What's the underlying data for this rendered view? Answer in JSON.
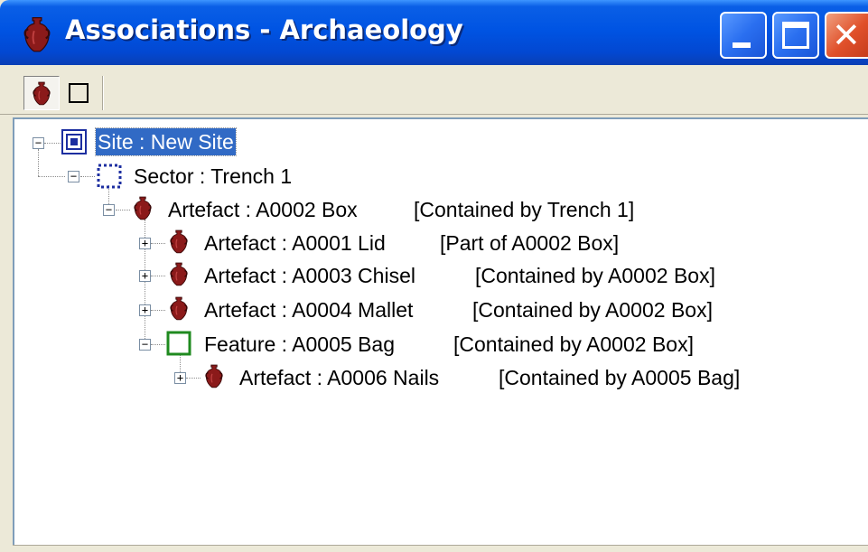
{
  "window": {
    "title": "Associations - Archaeology",
    "buttons": {
      "minimize": "minimize",
      "maximize": "maximize",
      "close": "close"
    }
  },
  "toolbar": {
    "items": [
      {
        "icon": "amphora-icon",
        "state": "pressed"
      },
      {
        "icon": "square-icon",
        "state": "normal"
      }
    ]
  },
  "tree": {
    "nodes": [
      {
        "label": "Site : New Site",
        "relation": "",
        "icon": "site-icon",
        "expander": "−",
        "selected": true
      },
      {
        "label": "Sector : Trench 1",
        "relation": "",
        "icon": "sector-icon",
        "expander": "−"
      },
      {
        "label": "Artefact : A0002 Box",
        "relation": "[Contained by Trench 1]",
        "icon": "amphora-icon",
        "expander": "−"
      },
      {
        "label": "Artefact : A0001 Lid",
        "relation": "[Part of A0002 Box]",
        "icon": "amphora-icon",
        "expander": "+"
      },
      {
        "label": "Artefact : A0003 Chisel",
        "relation": "[Contained by A0002 Box]",
        "icon": "amphora-icon",
        "expander": "+"
      },
      {
        "label": "Artefact : A0004 Mallet",
        "relation": "[Contained by A0002 Box]",
        "icon": "amphora-icon",
        "expander": "+"
      },
      {
        "label": "Feature : A0005 Bag",
        "relation": "[Contained by A0002 Box]",
        "icon": "feature-icon",
        "expander": "−"
      },
      {
        "label": "Artefact : A0006 Nails",
        "relation": "[Contained by A0005 Bag]",
        "icon": "amphora-icon",
        "expander": "+"
      }
    ]
  },
  "colors": {
    "titlebar": "#0054e3",
    "selection": "#316ac5",
    "artefact": "#8b1a1a",
    "site": "#1c2ea0",
    "feature": "#1f8a1f"
  }
}
